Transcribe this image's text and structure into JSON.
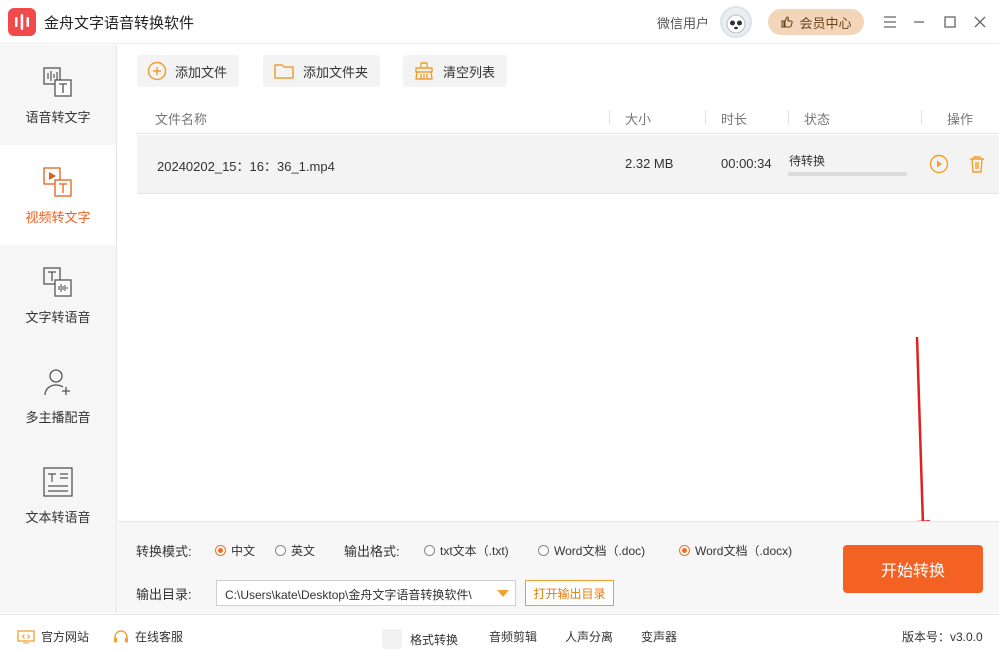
{
  "app": {
    "title": "金舟文字语音转换软件",
    "user_label": "微信用户",
    "vip_label": "会员中心"
  },
  "sidebar": {
    "items": [
      {
        "label": "语音转文字",
        "icon": "audio-to-text-icon",
        "active": false
      },
      {
        "label": "视频转文字",
        "icon": "video-to-text-icon",
        "active": true
      },
      {
        "label": "文字转语音",
        "icon": "text-to-audio-icon",
        "active": false
      },
      {
        "label": "多主播配音",
        "icon": "multi-voice-icon",
        "active": false
      },
      {
        "label": "文本转语音",
        "icon": "document-to-audio-icon",
        "active": false
      }
    ]
  },
  "toolbar": {
    "add_file": "添加文件",
    "add_folder": "添加文件夹",
    "clear_list": "清空列表"
  },
  "table": {
    "headers": {
      "name": "文件名称",
      "size": "大小",
      "duration": "时长",
      "status": "状态",
      "actions": "操作"
    },
    "rows": [
      {
        "name": "20240202_15：16：36_1.mp4",
        "size": "2.32 MB",
        "duration": "00:00:34",
        "status": "待转换",
        "progress": 0
      }
    ]
  },
  "settings": {
    "mode_label": "转换模式:",
    "mode_options": [
      {
        "label": "中文",
        "checked": true
      },
      {
        "label": "英文",
        "checked": false
      }
    ],
    "format_label": "输出格式:",
    "format_options": [
      {
        "label": "txt文本（.txt)",
        "checked": false
      },
      {
        "label": "Word文档（.doc)",
        "checked": false
      },
      {
        "label": "Word文档（.docx)",
        "checked": true
      }
    ],
    "output_label": "输出目录:",
    "output_path": "C:\\Users\\kate\\Desktop\\金舟文字语音转换软件\\",
    "open_dir": "打开输出目录",
    "start": "开始转换"
  },
  "statusbar": {
    "website": "官方网站",
    "support": "在线客服",
    "links": [
      "格式转换",
      "音频剪辑",
      "人声分离",
      "变声器"
    ],
    "version": "版本号：v3.0.0"
  },
  "colors": {
    "accent": "#f36222",
    "active_text": "#f06020",
    "vip_bg": "#f3d6b9",
    "logo": "#f24a4a"
  }
}
